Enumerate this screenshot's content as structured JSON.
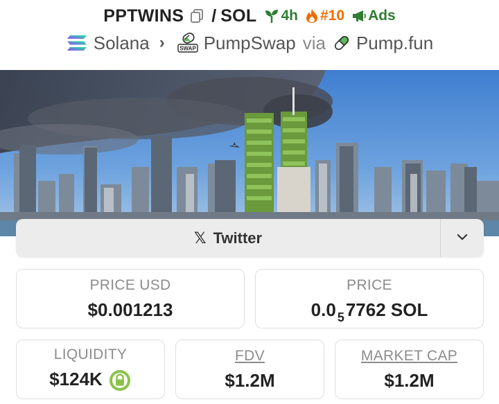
{
  "header": {
    "symbol": "PPTWINS",
    "slash": "/",
    "quote": "SOL",
    "age": "4h",
    "rank": "#10",
    "ads": "Ads"
  },
  "path": {
    "chain": "Solana",
    "dex": "PumpSwap",
    "via": "via",
    "launchpad": "Pump.fun",
    "swap_badge": "SWAP"
  },
  "social": {
    "x_glyph": "𝕏",
    "twitter_label": "Twitter"
  },
  "stats": {
    "price_usd": {
      "label": "PRICE USD",
      "value": "$0.001213"
    },
    "price": {
      "label": "PRICE",
      "value_prefix": "0.0",
      "value_sub": "5",
      "value_suffix": "7762 SOL"
    },
    "liquidity": {
      "label": "LIQUIDITY",
      "value": "$124K"
    },
    "fdv": {
      "label": "FDV",
      "value": "$1.2M"
    },
    "market_cap": {
      "label": "MARKET CAP",
      "value": "$1.2M"
    }
  },
  "colors": {
    "accent_green": "#2e7d32",
    "rank_orange": "#ef6c00",
    "lock_green": "#8bc34a"
  }
}
